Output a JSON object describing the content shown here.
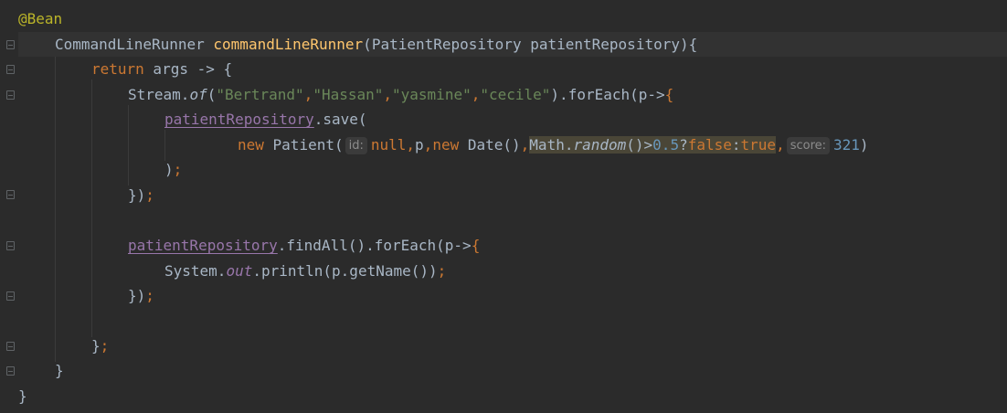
{
  "editor": {
    "language": "Java",
    "lines": {
      "l0": {
        "annotation": "@Bean"
      },
      "l1": {
        "type": "CommandLineRunner",
        "method": "commandLineRunner",
        "open_paren": "(",
        "param_type": "PatientRepository",
        "param_name": "patientRepository",
        "close": "){"
      },
      "l2": {
        "kw_return": "return",
        "rest": " args -> {"
      },
      "l3": {
        "stream": "Stream.",
        "of": "of",
        "paren": "(",
        "s1": "\"Bertrand\"",
        "s2": "\"Hassan\"",
        "s3": "\"yasmine\"",
        "s4": "\"cecile\"",
        "comma": ",",
        "tail": ").forEach(p->",
        "brace": "{"
      },
      "l4": {
        "field": "patientRepository",
        "call": ".save("
      },
      "l5": {
        "kw_new": "new",
        "ctor": " Patient(",
        "hint_id": "id:",
        "kw_null": "null",
        "comma": ",",
        "p": "p",
        "date": " Date()",
        "math": "Math.",
        "random": "random",
        "cmp": "()>",
        "num_half": "0.5",
        "q": "?",
        "kw_false": "false",
        "colon": ":",
        "kw_true": "true",
        "hint_score": "score:",
        "num_score": "321",
        "close": ")"
      },
      "l6": {
        "close": ")",
        "semi": ";"
      },
      "l7": {
        "close": "})",
        "semi": ";"
      },
      "l9": {
        "field": "patientRepository",
        "call": ".findAll().forEach(p->",
        "brace": "{"
      },
      "l10": {
        "sys": "System.",
        "out": "out",
        "call": ".println(p.getName())",
        "semi": ";"
      },
      "l11": {
        "close": "})",
        "semi": ";"
      },
      "l13": {
        "close": "}",
        "semi": ";"
      },
      "l14": {
        "close": "}"
      },
      "l15": {
        "close": "}"
      }
    }
  },
  "colors": {
    "background": "#2b2b2b",
    "keyword": "#cc7832",
    "method_decl": "#ffc66d",
    "string": "#6a8759",
    "number": "#6897bb",
    "field": "#9876aa",
    "annotation": "#bbb529",
    "default_text": "#a9b7c6"
  }
}
